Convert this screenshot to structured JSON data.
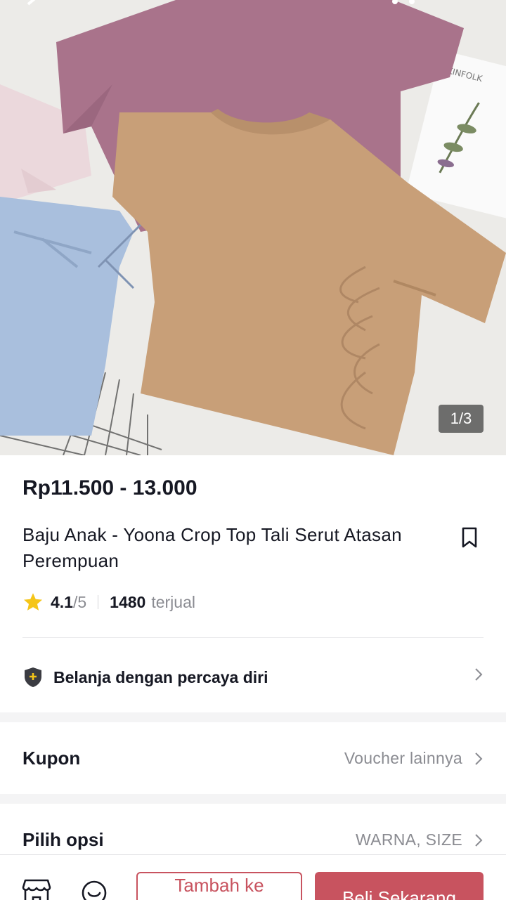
{
  "gallery": {
    "counter": "1/3"
  },
  "product": {
    "price": "Rp11.500 - 13.000",
    "title": "Baju Anak - Yoona Crop Top Tali Serut Atasan Perempuan",
    "rating": "4.1",
    "rating_max": "/5",
    "sold_count": "1480",
    "sold_label": "terjual"
  },
  "trust": {
    "label": "Belanja dengan percaya diri"
  },
  "coupon": {
    "label": "Kupon",
    "value": "Voucher lainnya"
  },
  "options": {
    "label": "Pilih opsi",
    "value": "WARNA, SIZE"
  },
  "actions": {
    "add_to_cart": "Tambah ke",
    "buy_now": "Beli Sekarang"
  },
  "colors": {
    "accent": "#c8535f",
    "star": "#f5c518",
    "muted": "#8a8b91"
  },
  "icons": [
    "bookmark-icon",
    "star-icon",
    "shield-icon",
    "chevron-right-icon",
    "shop-icon",
    "chat-icon"
  ]
}
